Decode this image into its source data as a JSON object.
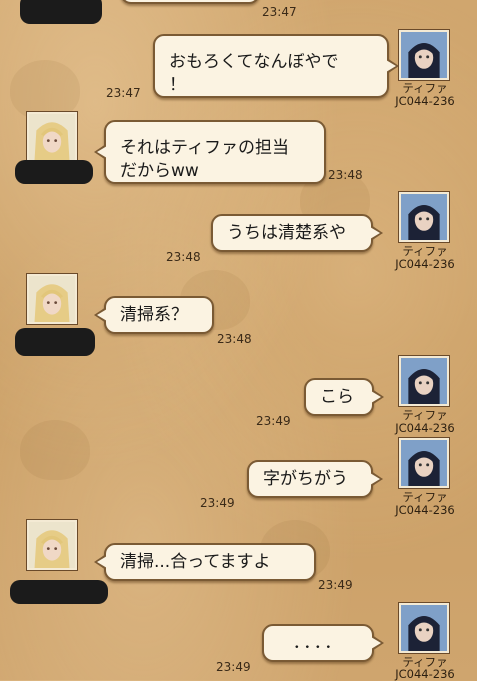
{
  "user_name": "ティファ",
  "user_code": "JC044-236",
  "messages": [
    {
      "text": "おもろくてなんぼやで！",
      "time": "23:47"
    },
    {
      "text": "それはティファの担当だからww",
      "time": "23:48"
    },
    {
      "text": "うちは清楚系や",
      "time": "23:48"
    },
    {
      "text": "清掃系？",
      "time": "23:48"
    },
    {
      "text": "こら",
      "time": "23:49"
    },
    {
      "text": "字がちがう",
      "time": "23:49"
    },
    {
      "text": "清掃...合ってますよ",
      "time": "23:49"
    },
    {
      "text": "．．．．",
      "time": "23:49"
    }
  ],
  "top_time": "23:47",
  "lines": {
    "m0a": "おもろくてなんぼやで",
    "m0b": "！",
    "m1a": "それはティファの担当",
    "m1b": "だからww",
    "m6": "清掃...合ってますよ"
  }
}
